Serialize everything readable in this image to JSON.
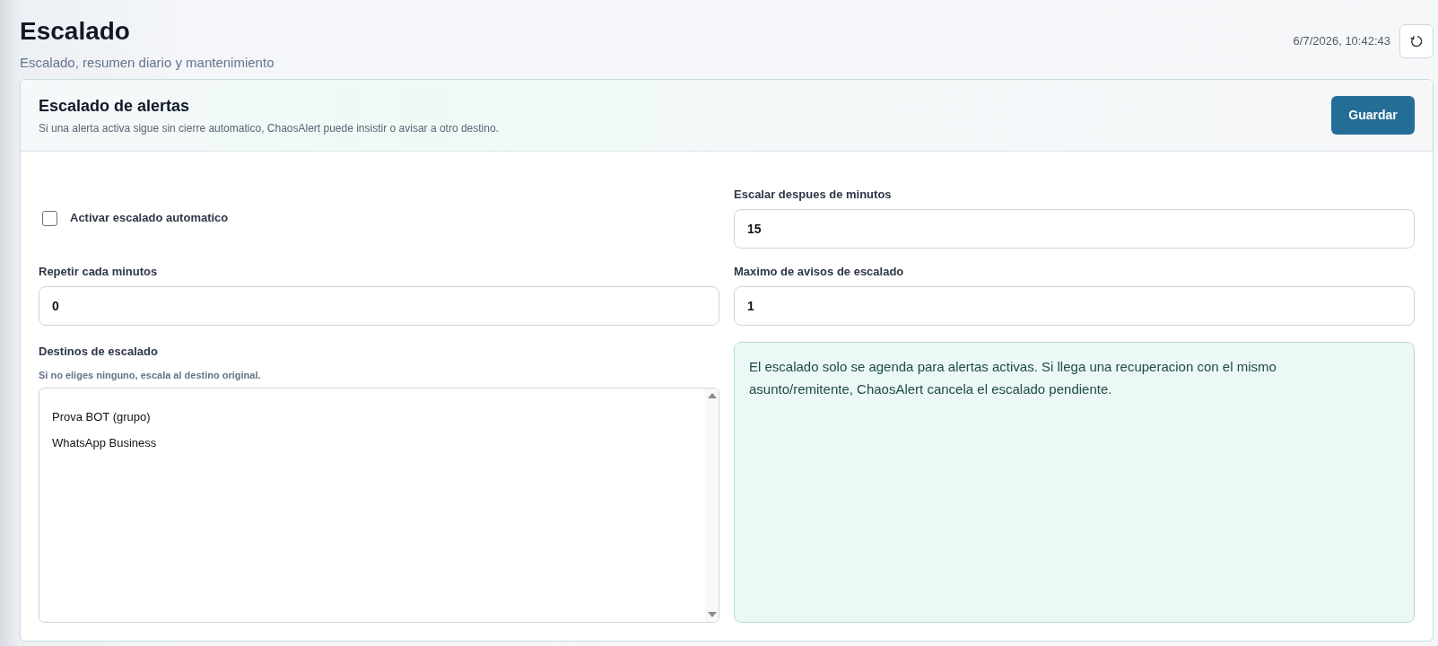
{
  "header": {
    "title": "Escalado",
    "subtitle": "Escalado, resumen diario y mantenimiento",
    "timestamp": "6/7/2026, 10:42:43"
  },
  "card": {
    "title": "Escalado de alertas",
    "description": "Si una alerta activa sigue sin cierre automatico, ChaosAlert puede insistir o avisar a otro destino.",
    "save_button": "Guardar"
  },
  "form": [
    {
      "kind": "checkbox",
      "label": "Activar escalado automatico",
      "checked": false
    },
    {
      "kind": "number",
      "label": "Escalar despues de minutos",
      "value": "15"
    },
    {
      "kind": "number",
      "label": "Repetir cada minutos",
      "value": "0"
    },
    {
      "kind": "number",
      "label": "Maximo de avisos de escalado",
      "value": "1"
    },
    {
      "kind": "multiselect",
      "label": "Destinos de escalado",
      "hint": "Si no eliges ninguno, escala al destino original.",
      "options": [
        {
          "label": "Prova BOT (grupo)",
          "selected": false
        },
        {
          "label": "WhatsApp Business",
          "selected": false
        }
      ]
    },
    {
      "kind": "note",
      "text": "El escalado solo se agenda para alertas activas. Si llega una recuperacion con el mismo asunto/remitente, ChaosAlert cancela el escalado pendiente."
    }
  ]
}
